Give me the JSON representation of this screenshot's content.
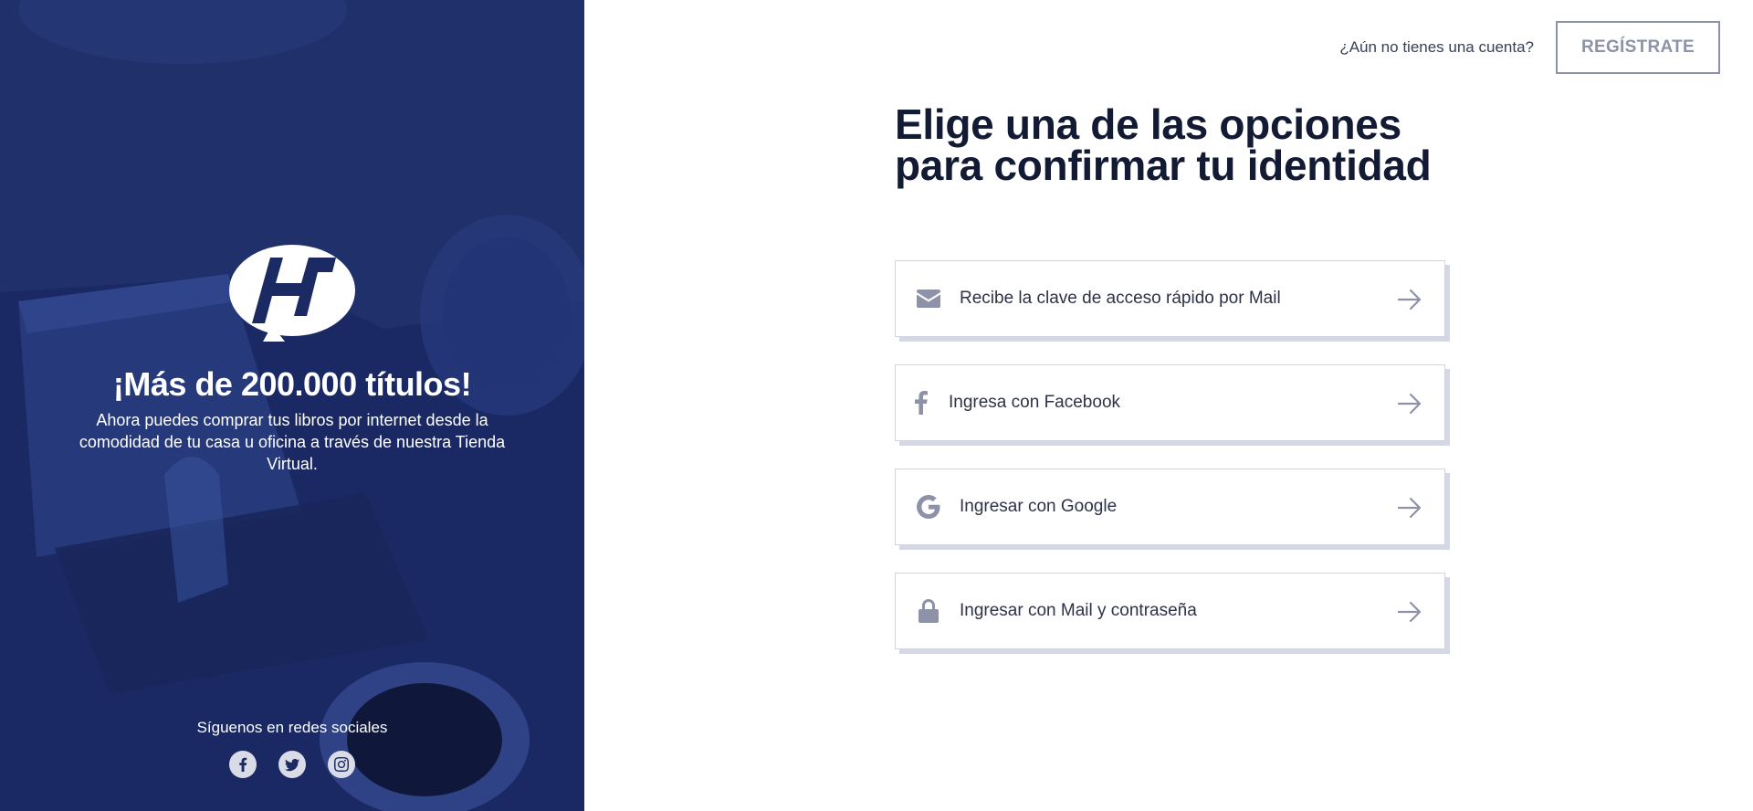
{
  "left_panel": {
    "title": "¡Más de 200.000 títulos!",
    "text": "Ahora puedes comprar tus libros por internet desde la comodidad de tu casa u oficina a través de nuestra Tienda Virtual.",
    "social_label": "Síguenos en redes sociales",
    "social_icons": [
      "facebook-icon",
      "twitter-icon",
      "instagram-icon"
    ],
    "background_color": "#1b2a63"
  },
  "topbar": {
    "prompt": "¿Aún no tienes una cuenta?",
    "register_label": "REGÍSTRATE"
  },
  "main": {
    "heading": "Elige una de las opciones para confirmar tu identidad",
    "options": [
      {
        "icon": "envelope-icon",
        "label": "Recibe la clave de acceso rápido por Mail"
      },
      {
        "icon": "facebook-icon",
        "label": "Ingresa con Facebook"
      },
      {
        "icon": "google-icon",
        "label": "Ingresar con Google"
      },
      {
        "icon": "lock-icon",
        "label": "Ingresar con Mail y contraseña"
      }
    ]
  },
  "colors": {
    "heading": "#131a33",
    "muted": "#8d92a8",
    "option_shadow": "#d3d7e6"
  }
}
